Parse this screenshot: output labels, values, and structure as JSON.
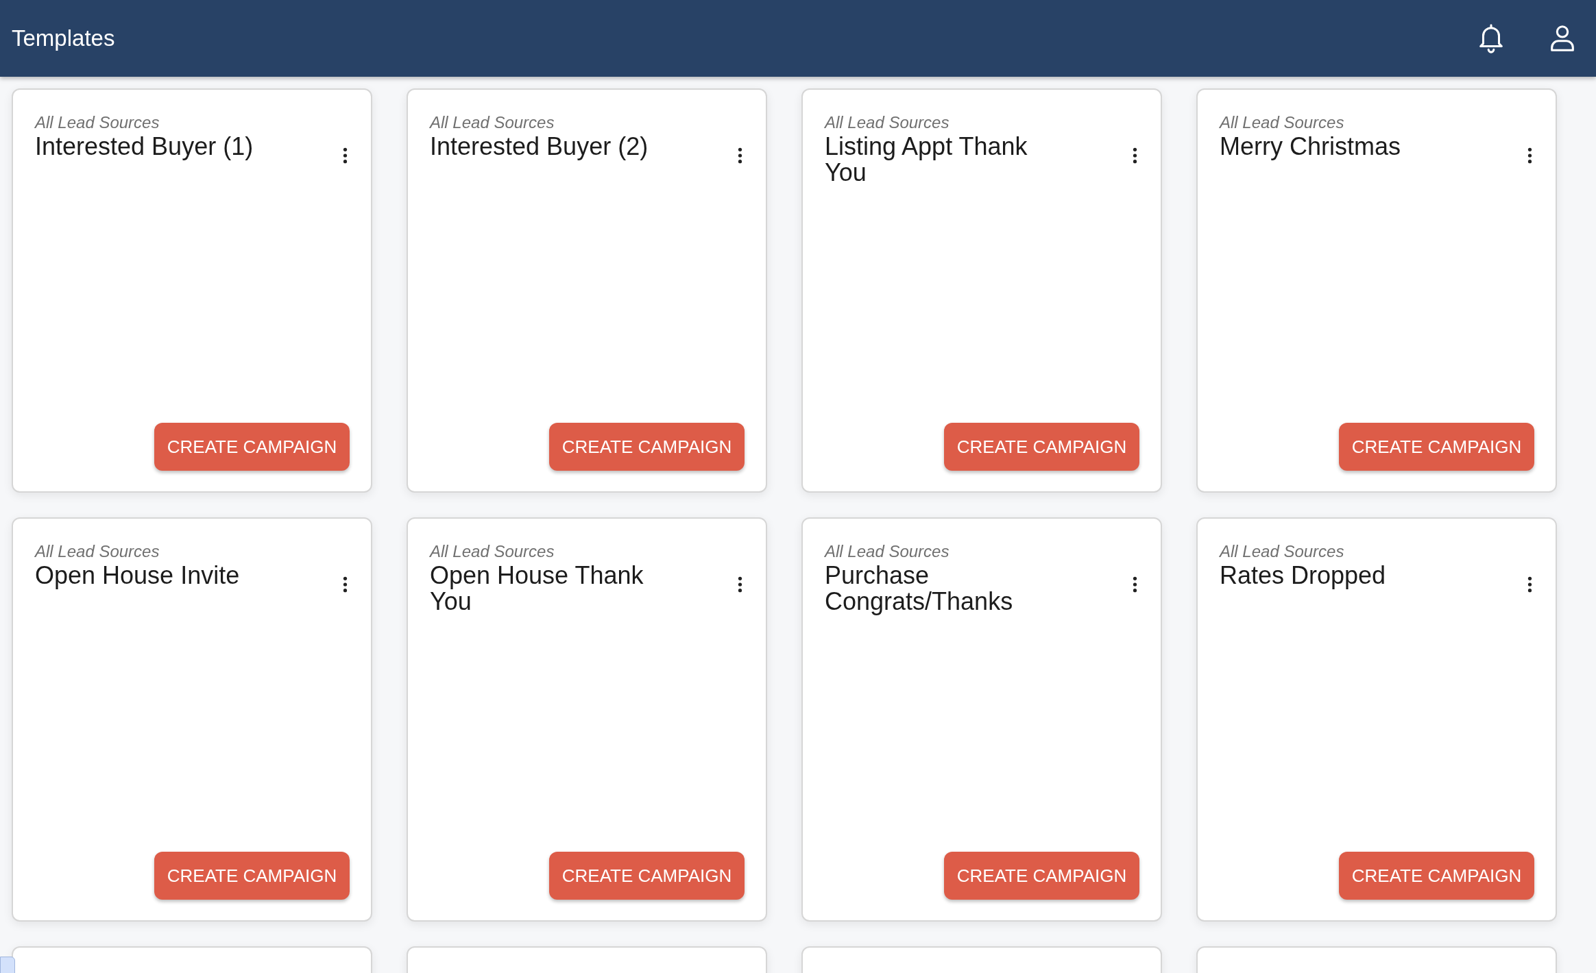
{
  "header": {
    "title": "Templates"
  },
  "templates": [
    {
      "source": "All Lead Sources",
      "title": "Interested Buyer (1)",
      "action": "CREATE CAMPAIGN"
    },
    {
      "source": "All Lead Sources",
      "title": "Interested Buyer (2)",
      "action": "CREATE CAMPAIGN"
    },
    {
      "source": "All Lead Sources",
      "title": "Listing Appt Thank You",
      "action": "CREATE CAMPAIGN"
    },
    {
      "source": "All Lead Sources",
      "title": "Merry Christmas",
      "action": "CREATE CAMPAIGN"
    },
    {
      "source": "All Lead Sources",
      "title": "Open House Invite",
      "action": "CREATE CAMPAIGN"
    },
    {
      "source": "All Lead Sources",
      "title": "Open House Thank You",
      "action": "CREATE CAMPAIGN"
    },
    {
      "source": "All Lead Sources",
      "title": "Purchase Congrats/Thanks",
      "action": "CREATE CAMPAIGN"
    },
    {
      "source": "All Lead Sources",
      "title": "Rates Dropped",
      "action": "CREATE CAMPAIGN"
    }
  ]
}
